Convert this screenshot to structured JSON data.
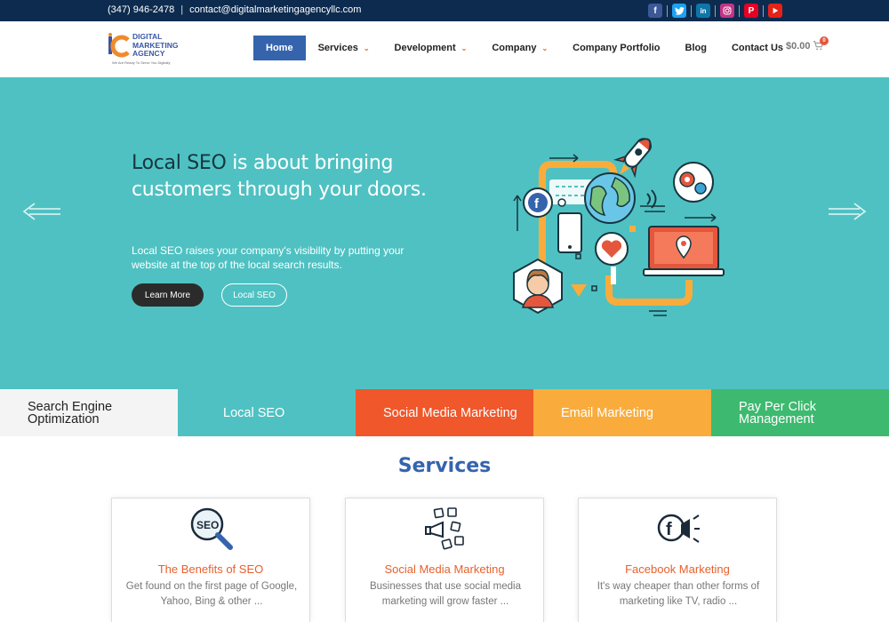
{
  "topbar": {
    "phone": "(347) 946-2478",
    "separator": "|",
    "email": "contact@digitalmarketingagencyllc.com",
    "social_icons": [
      "facebook-icon",
      "twitter-icon",
      "linkedin-icon",
      "instagram-icon",
      "pinterest-icon",
      "youtube-icon"
    ]
  },
  "logo": {
    "line1": "DIGITAL",
    "line2": "MARKETING",
    "line3": "AGENCY",
    "tagline": "We Are Ready To Serve You Digitally"
  },
  "nav": {
    "home": "Home",
    "services": "Services",
    "development": "Development",
    "company": "Company",
    "portfolio": "Company Portfolio",
    "blog": "Blog",
    "contact": "Contact Us"
  },
  "cart": {
    "amount": "$0.00",
    "count": "0"
  },
  "hero": {
    "headline_dark": "Local SEO",
    "headline_rest": " is about bringing customers through your doors.",
    "subtext": "Local SEO raises your company's visibility by putting your website at the top of the local search results.",
    "learn_more": "Learn More",
    "secondary_button": "Local SEO"
  },
  "tabs": [
    {
      "label": "Search Engine Optimization",
      "bg": "#f4f4f4",
      "color": "#222222"
    },
    {
      "label": "Local SEO",
      "bg": "#4fc1c2",
      "color": "#ffffff"
    },
    {
      "label": "Social Media Marketing",
      "bg": "#f0572a",
      "color": "#ffffff"
    },
    {
      "label": "Email Marketing",
      "bg": "#f9ac3c",
      "color": "#ffffff"
    },
    {
      "label": "Pay Per Click Management",
      "bg": "#3dba6f",
      "color": "#ffffff"
    }
  ],
  "services": {
    "title": "Services",
    "cards": [
      {
        "icon": "seo-magnifier-icon",
        "title": "The Benefits of SEO",
        "desc": "Get found on the first page of Google, Yahoo, Bing & other ..."
      },
      {
        "icon": "social-megaphone-icon",
        "title": "Social Media Marketing",
        "desc": "Businesses that use social media marketing will grow faster ..."
      },
      {
        "icon": "facebook-megaphone-icon",
        "title": "Facebook Marketing",
        "desc": "It's way cheaper than other forms of marketing like TV, radio ..."
      }
    ]
  },
  "colors": {
    "primary": "#3564ad",
    "accent": "#e8602d",
    "hero_bg": "#4fc1c2",
    "topbar_bg": "#0d2b4f"
  }
}
